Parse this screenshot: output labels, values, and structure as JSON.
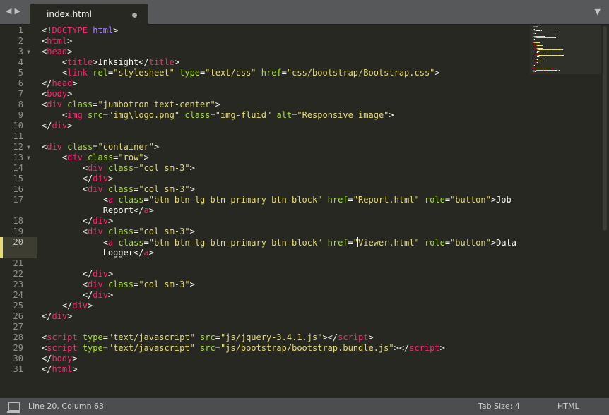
{
  "tab": {
    "title": "index.html"
  },
  "icons": {
    "nav": "nav-arrows-icon",
    "dirty": "unsaved-dot-icon",
    "tab_menu": "tab-menu-icon",
    "panel": "panel-toggle-icon"
  },
  "colors": {
    "tag": "#f92672",
    "attr": "#a6e22e",
    "string": "#e6db74",
    "plain": "#f8f8f2",
    "keyword": "#ae81ff",
    "background": "#272822"
  },
  "editor": {
    "current_line": 20,
    "lines": [
      {
        "n": "1",
        "fold": "",
        "parts": [
          [
            "p",
            "<!"
          ],
          [
            "d",
            "DOCTYPE"
          ],
          [
            "p",
            " "
          ],
          [
            "k",
            "html"
          ],
          [
            "p",
            ">"
          ]
        ]
      },
      {
        "n": "2",
        "fold": "",
        "parts": [
          [
            "p",
            "<"
          ],
          [
            "t",
            "html"
          ],
          [
            "p",
            ">"
          ]
        ]
      },
      {
        "n": "3",
        "fold": "▼",
        "parts": [
          [
            "p",
            "<"
          ],
          [
            "t",
            "head"
          ],
          [
            "p",
            ">"
          ]
        ]
      },
      {
        "n": "4",
        "fold": "",
        "parts": [
          [
            "p",
            "    <"
          ],
          [
            "t",
            "title"
          ],
          [
            "p",
            ">Inksight</"
          ],
          [
            "t",
            "title"
          ],
          [
            "p",
            ">"
          ]
        ]
      },
      {
        "n": "5",
        "fold": "",
        "parts": [
          [
            "p",
            "    <"
          ],
          [
            "t",
            "link"
          ],
          [
            "p",
            " "
          ],
          [
            "a",
            "rel"
          ],
          [
            "p",
            "="
          ],
          [
            "s",
            "\"stylesheet\""
          ],
          [
            "p",
            " "
          ],
          [
            "a",
            "type"
          ],
          [
            "p",
            "="
          ],
          [
            "s",
            "\"text/css\""
          ],
          [
            "p",
            " "
          ],
          [
            "a",
            "href"
          ],
          [
            "p",
            "="
          ],
          [
            "s",
            "\"css/bootstrap/Bootstrap.css\""
          ],
          [
            "p",
            ">"
          ]
        ]
      },
      {
        "n": "6",
        "fold": "",
        "parts": [
          [
            "p",
            "</"
          ],
          [
            "t",
            "head"
          ],
          [
            "p",
            ">"
          ]
        ]
      },
      {
        "n": "7",
        "fold": "",
        "parts": [
          [
            "p",
            "<"
          ],
          [
            "t",
            "body"
          ],
          [
            "p",
            ">"
          ]
        ]
      },
      {
        "n": "8",
        "fold": "",
        "parts": [
          [
            "p",
            "<"
          ],
          [
            "t",
            "div"
          ],
          [
            "p",
            " "
          ],
          [
            "a",
            "class"
          ],
          [
            "p",
            "="
          ],
          [
            "s",
            "\"jumbotron text-center\""
          ],
          [
            "p",
            ">"
          ]
        ]
      },
      {
        "n": "9",
        "fold": "",
        "parts": [
          [
            "p",
            "    <"
          ],
          [
            "t",
            "img"
          ],
          [
            "p",
            " "
          ],
          [
            "a",
            "src"
          ],
          [
            "p",
            "="
          ],
          [
            "s",
            "\"img\\logo.png\""
          ],
          [
            "p",
            " "
          ],
          [
            "a",
            "class"
          ],
          [
            "p",
            "="
          ],
          [
            "s",
            "\"img-fluid\""
          ],
          [
            "p",
            " "
          ],
          [
            "a",
            "alt"
          ],
          [
            "p",
            "="
          ],
          [
            "s",
            "\"Responsive image\""
          ],
          [
            "p",
            ">"
          ]
        ]
      },
      {
        "n": "10",
        "fold": "",
        "parts": [
          [
            "p",
            "</"
          ],
          [
            "t",
            "div"
          ],
          [
            "p",
            ">"
          ]
        ]
      },
      {
        "n": "11",
        "fold": "",
        "parts": []
      },
      {
        "n": "12",
        "fold": "▼",
        "parts": [
          [
            "p",
            "<"
          ],
          [
            "t",
            "div"
          ],
          [
            "p",
            " "
          ],
          [
            "a",
            "class"
          ],
          [
            "p",
            "="
          ],
          [
            "s",
            "\"container\""
          ],
          [
            "p",
            ">"
          ]
        ]
      },
      {
        "n": "13",
        "fold": "▼",
        "parts": [
          [
            "p",
            "    <"
          ],
          [
            "t",
            "div"
          ],
          [
            "p",
            " "
          ],
          [
            "a",
            "class"
          ],
          [
            "p",
            "="
          ],
          [
            "s",
            "\"row\""
          ],
          [
            "p",
            ">"
          ]
        ]
      },
      {
        "n": "14",
        "fold": "",
        "parts": [
          [
            "p",
            "        <"
          ],
          [
            "t",
            "div"
          ],
          [
            "p",
            " "
          ],
          [
            "a",
            "class"
          ],
          [
            "p",
            "="
          ],
          [
            "s",
            "\"col sm-3\""
          ],
          [
            "p",
            ">"
          ]
        ]
      },
      {
        "n": "15",
        "fold": "",
        "parts": [
          [
            "p",
            "        </"
          ],
          [
            "t",
            "div"
          ],
          [
            "p",
            ">"
          ]
        ]
      },
      {
        "n": "16",
        "fold": "",
        "parts": [
          [
            "p",
            "        <"
          ],
          [
            "t",
            "div"
          ],
          [
            "p",
            " "
          ],
          [
            "a",
            "class"
          ],
          [
            "p",
            "="
          ],
          [
            "s",
            "\"col sm-3\""
          ],
          [
            "p",
            ">"
          ]
        ]
      },
      {
        "n": "17",
        "fold": "",
        "parts": [
          [
            "p",
            "            <"
          ],
          [
            "t",
            "a"
          ],
          [
            "p",
            " "
          ],
          [
            "a",
            "class"
          ],
          [
            "p",
            "="
          ],
          [
            "s",
            "\"btn btn-lg btn-primary btn-block\""
          ],
          [
            "p",
            " "
          ],
          [
            "a",
            "href"
          ],
          [
            "p",
            "="
          ],
          [
            "s",
            "\"Report.html\""
          ],
          [
            "p",
            " "
          ],
          [
            "a",
            "role"
          ],
          [
            "p",
            "="
          ],
          [
            "s",
            "\"button\""
          ],
          [
            "p",
            ">Job"
          ]
        ]
      },
      {
        "n": "",
        "fold": "",
        "parts": [
          [
            "p",
            "            Report</"
          ],
          [
            "t",
            "a"
          ],
          [
            "p",
            ">"
          ]
        ]
      },
      {
        "n": "18",
        "fold": "",
        "parts": [
          [
            "p",
            "        </"
          ],
          [
            "t",
            "div"
          ],
          [
            "p",
            ">"
          ]
        ]
      },
      {
        "n": "19",
        "fold": "",
        "parts": [
          [
            "p",
            "        <"
          ],
          [
            "t",
            "div"
          ],
          [
            "p",
            " "
          ],
          [
            "a",
            "class"
          ],
          [
            "p",
            "="
          ],
          [
            "s",
            "\"col sm-3\""
          ],
          [
            "p",
            ">"
          ]
        ]
      },
      {
        "n": "20",
        "fold": "",
        "parts": [
          [
            "p",
            "            <"
          ],
          [
            "tu",
            "a"
          ],
          [
            "p",
            " "
          ],
          [
            "a",
            "class"
          ],
          [
            "p",
            "="
          ],
          [
            "s",
            "\"btn btn-lg btn-primary btn-block\""
          ],
          [
            "p",
            " "
          ],
          [
            "a",
            "href"
          ],
          [
            "p",
            "="
          ],
          [
            "s",
            "\""
          ],
          [
            "caret",
            ""
          ],
          [
            "s",
            "Viewer.html\""
          ],
          [
            "p",
            " "
          ],
          [
            "a",
            "role"
          ],
          [
            "p",
            "="
          ],
          [
            "s",
            "\"button\""
          ],
          [
            "p",
            ">Data"
          ]
        ]
      },
      {
        "n": "",
        "fold": "",
        "parts": [
          [
            "p",
            "            Logger</"
          ],
          [
            "tu",
            "a"
          ],
          [
            "p",
            ">"
          ]
        ]
      },
      {
        "n": "21",
        "fold": "",
        "parts": []
      },
      {
        "n": "22",
        "fold": "",
        "parts": [
          [
            "p",
            "        </"
          ],
          [
            "t",
            "div"
          ],
          [
            "p",
            ">"
          ]
        ]
      },
      {
        "n": "23",
        "fold": "",
        "parts": [
          [
            "p",
            "        <"
          ],
          [
            "t",
            "div"
          ],
          [
            "p",
            " "
          ],
          [
            "a",
            "class"
          ],
          [
            "p",
            "="
          ],
          [
            "s",
            "\"col sm-3\""
          ],
          [
            "p",
            ">"
          ]
        ]
      },
      {
        "n": "24",
        "fold": "",
        "parts": [
          [
            "p",
            "        </"
          ],
          [
            "t",
            "div"
          ],
          [
            "p",
            ">"
          ]
        ]
      },
      {
        "n": "25",
        "fold": "",
        "parts": [
          [
            "p",
            "    </"
          ],
          [
            "t",
            "div"
          ],
          [
            "p",
            ">"
          ]
        ]
      },
      {
        "n": "26",
        "fold": "",
        "parts": [
          [
            "p",
            "</"
          ],
          [
            "t",
            "div"
          ],
          [
            "p",
            ">"
          ]
        ]
      },
      {
        "n": "27",
        "fold": "",
        "parts": []
      },
      {
        "n": "28",
        "fold": "",
        "parts": [
          [
            "p",
            "<"
          ],
          [
            "t",
            "script"
          ],
          [
            "p",
            " "
          ],
          [
            "a",
            "type"
          ],
          [
            "p",
            "="
          ],
          [
            "s",
            "\"text/javascript\""
          ],
          [
            "p",
            " "
          ],
          [
            "a",
            "src"
          ],
          [
            "p",
            "="
          ],
          [
            "s",
            "\"js/jquery-3.4.1.js\""
          ],
          [
            "p",
            "></"
          ],
          [
            "t",
            "script"
          ],
          [
            "p",
            ">"
          ]
        ]
      },
      {
        "n": "29",
        "fold": "",
        "parts": [
          [
            "p",
            "<"
          ],
          [
            "t",
            "script"
          ],
          [
            "p",
            " "
          ],
          [
            "a",
            "type"
          ],
          [
            "p",
            "="
          ],
          [
            "s",
            "\"text/javascript\""
          ],
          [
            "p",
            " "
          ],
          [
            "a",
            "src"
          ],
          [
            "p",
            "="
          ],
          [
            "s",
            "\"js/bootstrap/bootstrap.bundle.js\""
          ],
          [
            "p",
            "></"
          ],
          [
            "t",
            "script"
          ],
          [
            "p",
            ">"
          ]
        ]
      },
      {
        "n": "30",
        "fold": "",
        "parts": [
          [
            "p",
            "</"
          ],
          [
            "t",
            "body"
          ],
          [
            "p",
            ">"
          ]
        ]
      },
      {
        "n": "31",
        "fold": "",
        "parts": [
          [
            "p",
            "</"
          ],
          [
            "t",
            "html"
          ],
          [
            "p",
            ">"
          ]
        ]
      }
    ]
  },
  "status": {
    "position": "Line 20, Column 63",
    "tab_size": "Tab Size: 4",
    "syntax": "HTML"
  }
}
